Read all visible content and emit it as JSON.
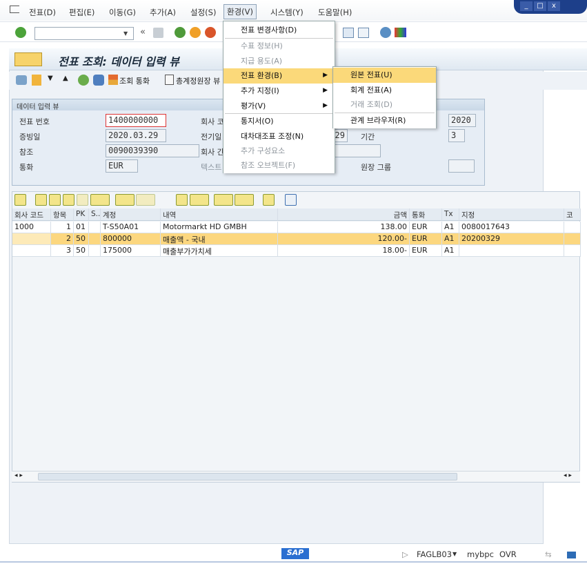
{
  "menubar": {
    "items": [
      "전표(D)",
      "편집(E)",
      "이동(G)",
      "추가(A)",
      "설정(S)",
      "환경(V)",
      "시스템(Y)",
      "도움말(H)"
    ]
  },
  "window_controls": {
    "minimize": "_",
    "maximize": "□",
    "close": "x"
  },
  "toolbar": {
    "command_value": "",
    "back_label": "«"
  },
  "title": "전표 조회: 데이터 입력 뷰",
  "app_toolbar": {
    "currency_label": "조회 통화",
    "ledger_label": "총계정원장 뷰"
  },
  "group": {
    "title": "데이터 입력 뷰",
    "fields": [
      {
        "label": "전표 번호",
        "value": "1400000000"
      },
      {
        "label": "증빙일",
        "value": "2020.03.29"
      },
      {
        "label": "참조",
        "value": "0090039390"
      },
      {
        "label": "통화",
        "value": "EUR"
      }
    ],
    "mid_labels": [
      "회사 코",
      "전기일",
      "회사 간",
      "텍스트"
    ],
    "posting_date_tail": "29",
    "right": [
      {
        "label": "",
        "value": "2020"
      },
      {
        "label": "기간",
        "value": "3"
      },
      {
        "label": "원장 그룹",
        "value": ""
      }
    ]
  },
  "table": {
    "headers": [
      "회사 코드",
      "항목",
      "PK",
      "S...",
      "계정",
      "내역",
      "금액",
      "통화",
      "Tx",
      "지정",
      "코스"
    ],
    "rows": [
      [
        "1000",
        "1",
        "01",
        "",
        "T-S50A01",
        "Motormarkt HD GMBH",
        "138.00",
        "EUR",
        "A1",
        "0080017643",
        ""
      ],
      [
        "",
        "2",
        "50",
        "",
        "800000",
        "매출액 - 국내",
        "120.00-",
        "EUR",
        "A1",
        "20200329",
        ""
      ],
      [
        "",
        "3",
        "50",
        "",
        "175000",
        "매출부가가치세",
        "18.00-",
        "EUR",
        "A1",
        "",
        ""
      ]
    ],
    "selected_row": 1
  },
  "menu": {
    "items": [
      {
        "label": "전표 변경사항(D)",
        "enabled": true
      },
      {
        "label": "수표 정보(H)",
        "enabled": false
      },
      {
        "label": "지급 용도(A)",
        "enabled": false
      },
      {
        "label": "전표 환경(B)",
        "enabled": true,
        "submenu": true
      },
      {
        "label": "추가 지정(I)",
        "enabled": true,
        "submenu": true
      },
      {
        "label": "평가(V)",
        "enabled": true,
        "submenu": true
      },
      {
        "label": "통지서(O)",
        "enabled": true
      },
      {
        "label": "대차대조표 조정(N)",
        "enabled": true
      },
      {
        "label": "추가 구성요소",
        "enabled": false
      },
      {
        "label": "참조 오브젝트(F)",
        "enabled": false
      }
    ]
  },
  "submenu": {
    "items": [
      {
        "label": "원본 전표(U)",
        "enabled": true
      },
      {
        "label": "회계 전표(A)",
        "enabled": true
      },
      {
        "label": "거래 조회(D)",
        "enabled": false
      },
      {
        "label": "관계 브라우저(R)",
        "enabled": true
      }
    ]
  },
  "status": {
    "logo": "SAP",
    "transaction": "FAGLB03",
    "server": "mybpc",
    "mode": "OVR"
  },
  "colors": {
    "highlight": "#fbd97a",
    "selected_row": "#fcd77f",
    "brand": "#1d3f8a"
  }
}
